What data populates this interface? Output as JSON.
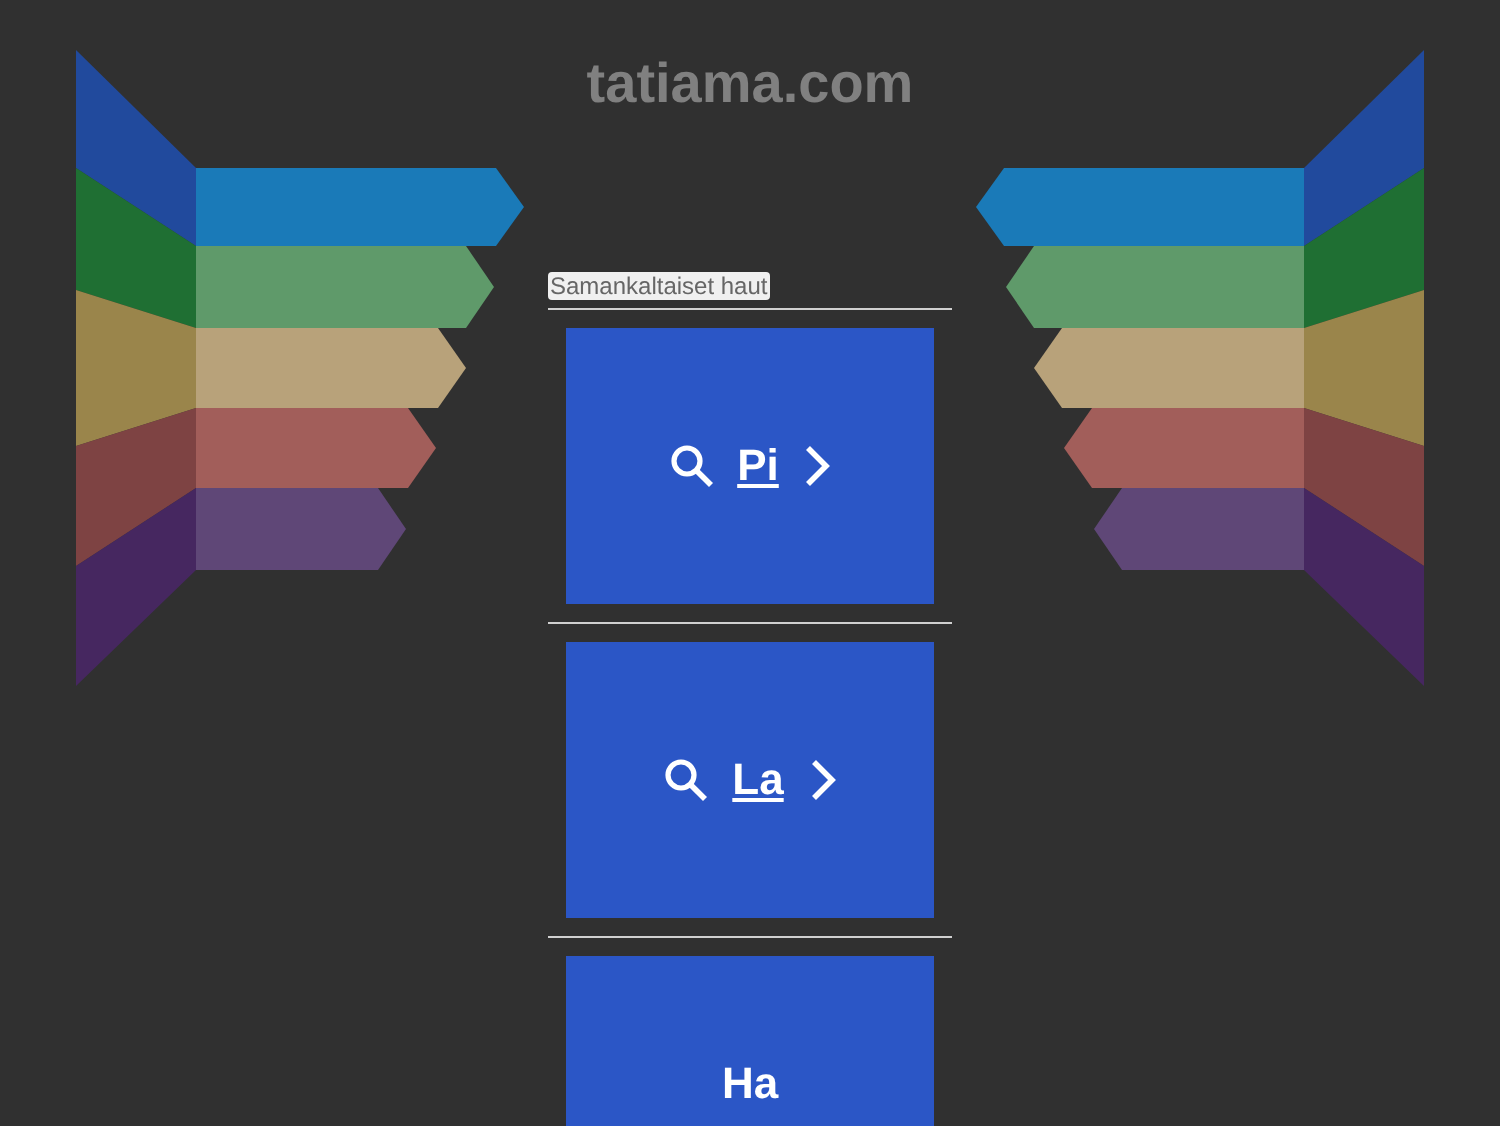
{
  "site_title": "tatiama.com",
  "related_label": "Samankaltaiset haut",
  "results": [
    {
      "text": "Pi",
      "kind": "link"
    },
    {
      "text": "La",
      "kind": "link"
    },
    {
      "text": "Ha",
      "kind": "plain"
    }
  ]
}
